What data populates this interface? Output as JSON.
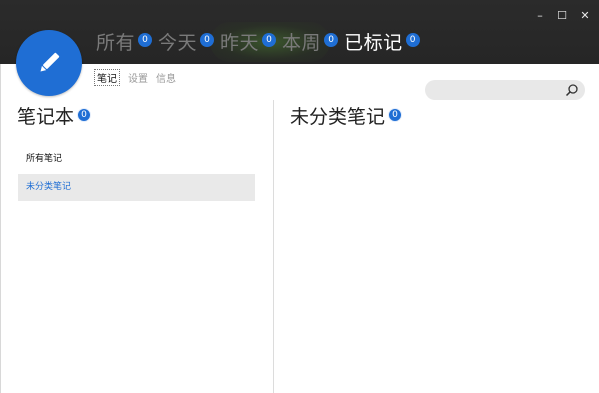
{
  "window": {
    "minimize": "–",
    "maximize": "☐",
    "close": "✕"
  },
  "tabs": [
    {
      "label": "所有",
      "count": "0",
      "active": false
    },
    {
      "label": "今天",
      "count": "0",
      "active": false
    },
    {
      "label": "昨天",
      "count": "0",
      "active": false
    },
    {
      "label": "本周",
      "count": "0",
      "active": false
    },
    {
      "label": "已标记",
      "count": "0",
      "active": true
    }
  ],
  "subnav": {
    "notes": "笔记",
    "settings": "设置",
    "info": "信息"
  },
  "search": {
    "placeholder": "",
    "icon": "search-icon"
  },
  "notebooks": {
    "title": "笔记本",
    "count": "0",
    "items": [
      {
        "label": "所有笔记",
        "selected": false
      },
      {
        "label": "未分类笔记",
        "selected": true
      }
    ]
  },
  "notes_panel": {
    "title": "未分类笔记",
    "count": "0"
  },
  "colors": {
    "accent": "#1f6ed4",
    "header": "#262626",
    "selected_row": "#e9e9e9"
  }
}
